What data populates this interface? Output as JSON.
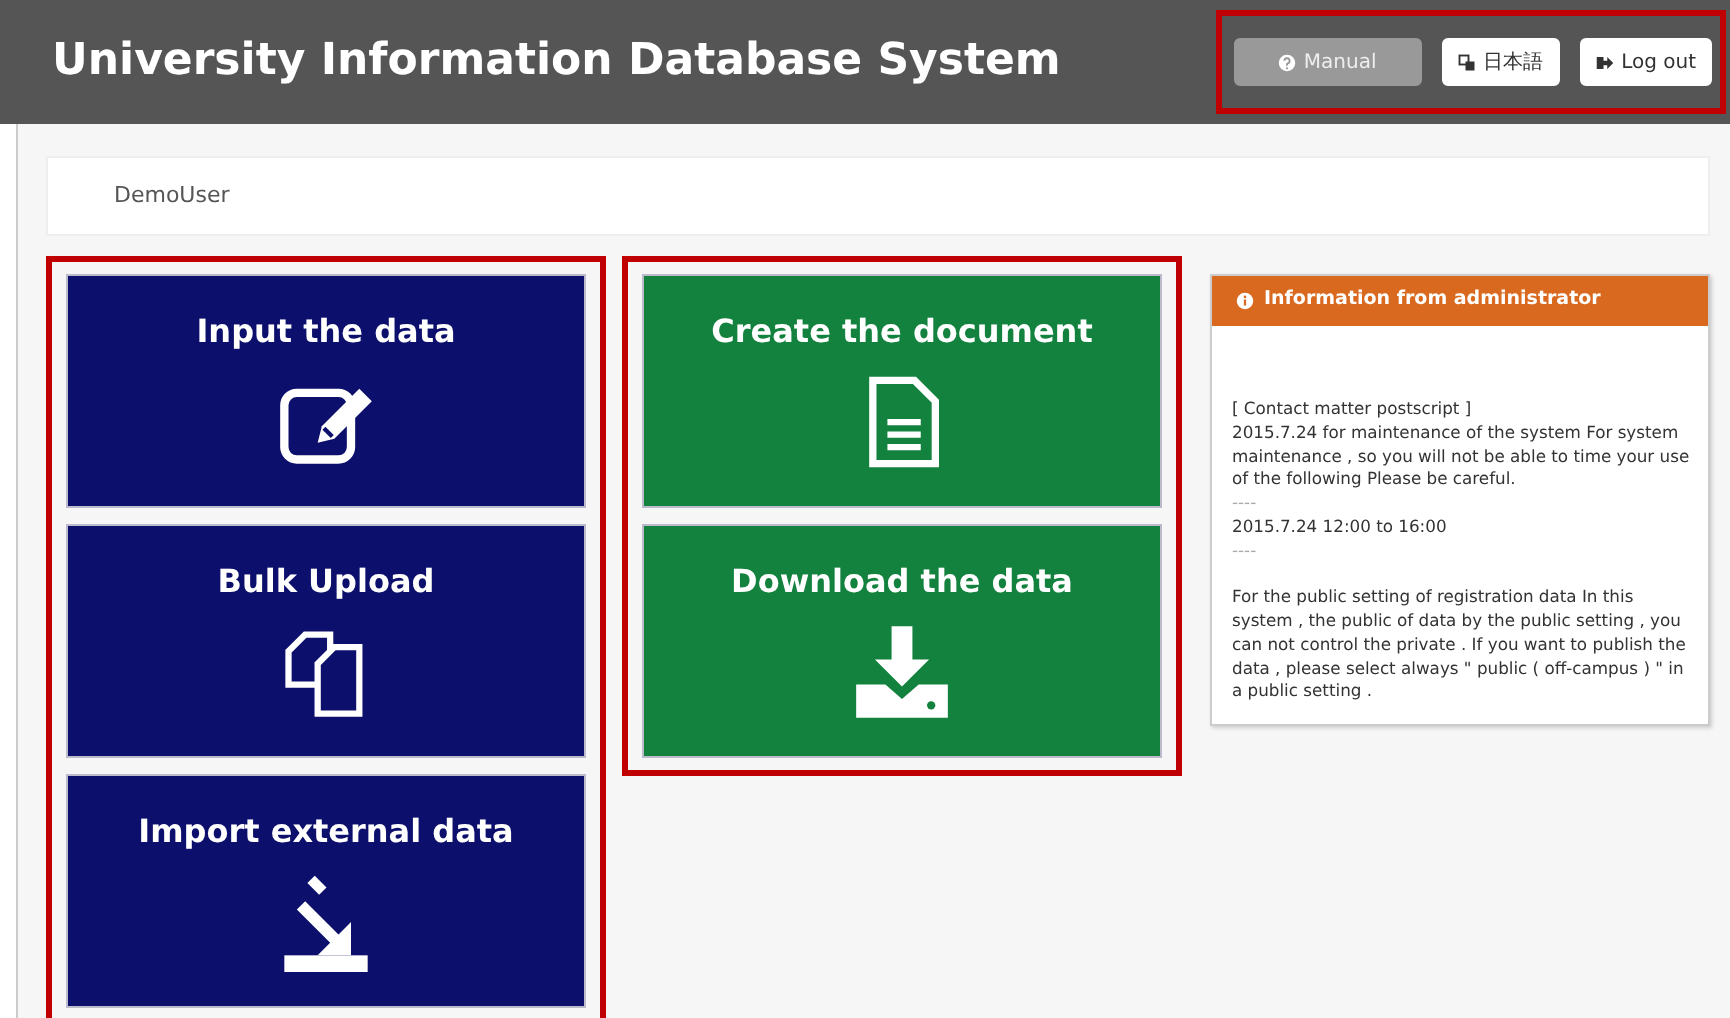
{
  "header": {
    "title": "University Information Database System",
    "buttons": [
      {
        "label": "Manual",
        "kind": "help",
        "disabled": true
      },
      {
        "label": "日本語",
        "kind": "language",
        "disabled": false
      },
      {
        "label": "Log out",
        "kind": "logout",
        "disabled": false
      }
    ]
  },
  "user": "DemoUser",
  "tile_columns": [
    {
      "color": "#0c0f6b",
      "tiles": [
        {
          "label": "Input the data",
          "kind": "edit"
        },
        {
          "label": "Bulk Upload",
          "kind": "copy"
        },
        {
          "label": "Import external data",
          "kind": "import"
        }
      ]
    },
    {
      "color": "#13823f",
      "tiles": [
        {
          "label": "Create the document",
          "kind": "document"
        },
        {
          "label": "Download the data",
          "kind": "download"
        }
      ]
    }
  ],
  "info_panel": {
    "title": "Information from administrator",
    "paragraphs": [
      [
        "[ Contact matter postscript ]",
        "2015.7.24 for maintenance of the system For system maintenance , so you will not be able to time your use of the following Please be careful.",
        "----",
        "2015.7.24 12:00 to 16:00",
        "----"
      ],
      [
        "For the public setting of registration data In this system , the public of data by the public setting , you can not control the private . If you want to publish the data , please select always \" public ( off-campus ) \" in a public setting ."
      ]
    ]
  }
}
